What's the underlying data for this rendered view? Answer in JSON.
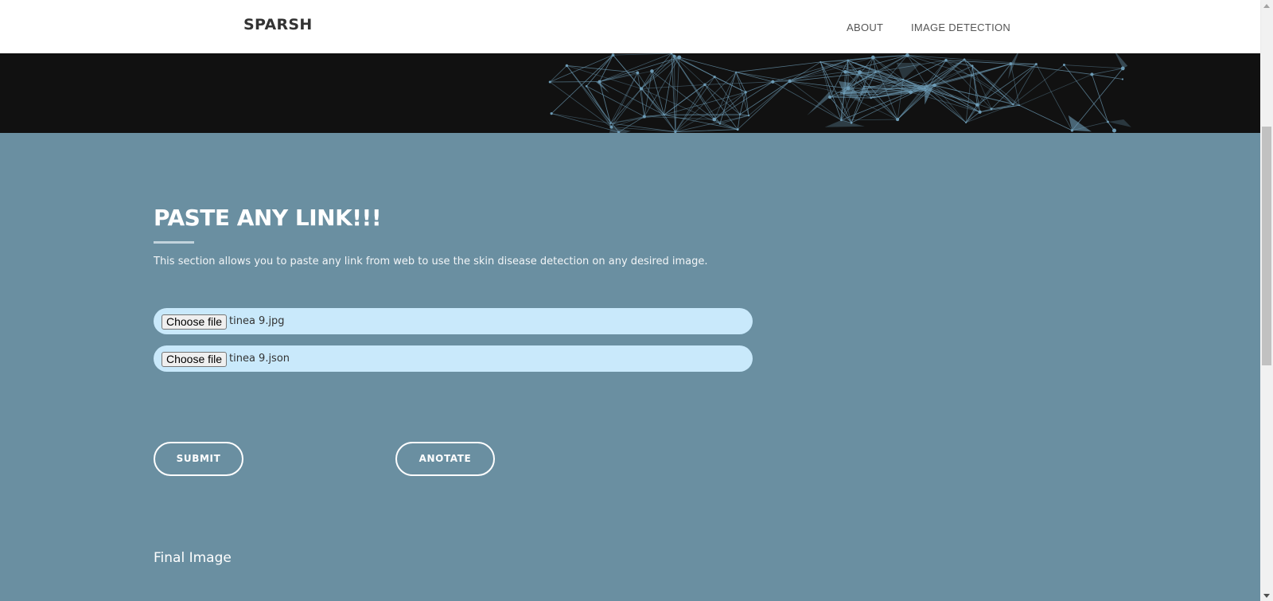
{
  "navbar": {
    "brand": "SPARSH",
    "links": [
      {
        "label": "ABOUT"
      },
      {
        "label": "IMAGE DETECTION"
      }
    ]
  },
  "hero": {
    "background_color": "#111111",
    "pattern_color": "#6d9bb5"
  },
  "main": {
    "background_color": "#6a8fa1",
    "title": "PASTE ANY LINK!!!",
    "description": "This section allows you to paste any link from web to use the skin disease detection on any desired image.",
    "file_inputs": [
      {
        "button_label": "Choose file",
        "file_name": "tinea 9.jpg"
      },
      {
        "button_label": "Choose file",
        "file_name": "tinea 9.json"
      }
    ],
    "buttons": {
      "submit": "SUBMIT",
      "anotate": "ANOTATE"
    },
    "final_image_label": "Final Image"
  },
  "colors": {
    "input_background": "#c9e9fb",
    "text_white": "#ffffff"
  }
}
